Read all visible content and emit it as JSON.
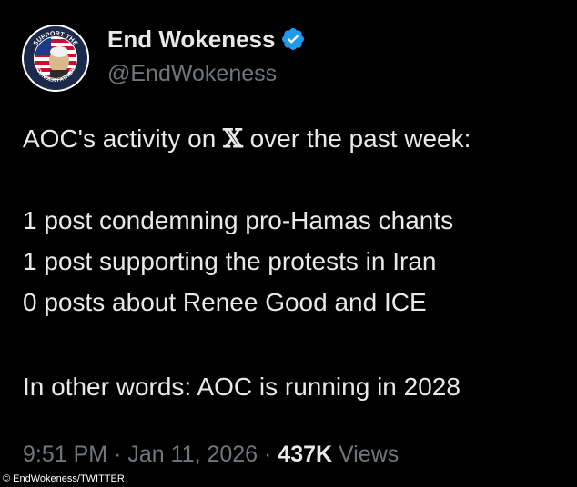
{
  "tweet": {
    "author": {
      "display_name": "End Wokeness",
      "handle": "@EndWokeness",
      "verified": true,
      "avatar_text_top": "SUPPORT THE",
      "avatar_text_bottom": "FOUNDER FATHERS"
    },
    "body": {
      "line1_prefix": "AOC's activity on ",
      "line1_x": "𝕏",
      "line1_suffix": " over the past week:",
      "line2": "1 post condemning pro-Hamas chants",
      "line3": "1 post supporting the protests in Iran",
      "line4": "0 posts about Renee Good and ICE",
      "line5": "In other words: AOC is running in 2028"
    },
    "meta": {
      "time": "9:51 PM",
      "separator": "·",
      "date": "Jan 11, 2026",
      "views_count": "437K",
      "views_label": "Views"
    }
  },
  "credit": "© EndWokeness/TWITTER",
  "colors": {
    "background": "#000000",
    "text_primary": "#e7e9ea",
    "text_secondary": "#71767b",
    "verified_blue": "#1d9bf0"
  }
}
